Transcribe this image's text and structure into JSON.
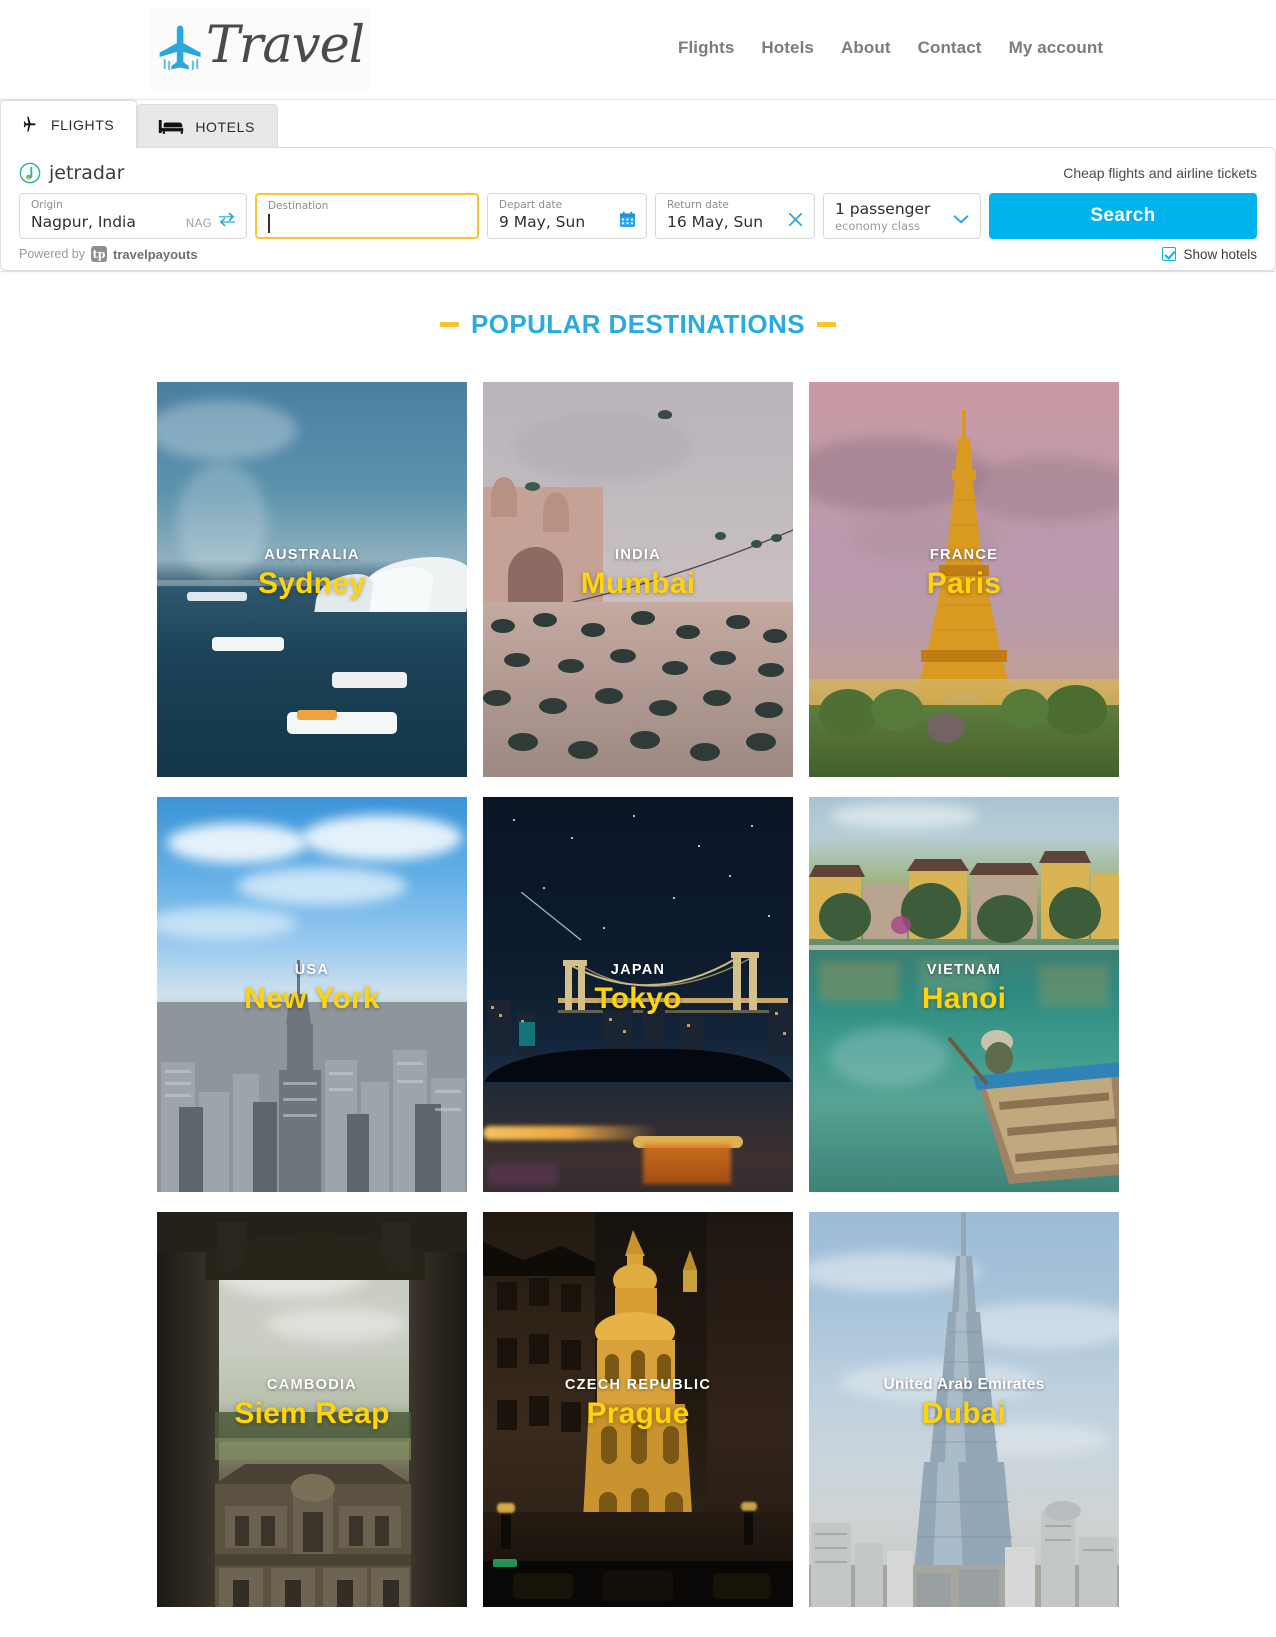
{
  "header": {
    "logo_text": "Travel",
    "logo_icon": "airplane-icon",
    "nav": [
      {
        "label": "Flights"
      },
      {
        "label": "Hotels"
      },
      {
        "label": "About"
      },
      {
        "label": "Contact"
      },
      {
        "label": "My account"
      }
    ]
  },
  "search_widget": {
    "tabs": [
      {
        "label": "FLIGHTS",
        "icon": "airplane-icon",
        "active": true
      },
      {
        "label": "HOTELS",
        "icon": "bed-icon",
        "active": false
      }
    ],
    "brand": "jetradar",
    "tagline": "Cheap flights and airline tickets",
    "origin": {
      "label": "Origin",
      "value": "Nagpur, India",
      "code": "NAG",
      "swap_icon": "swap-arrows-icon"
    },
    "destination": {
      "label": "Destination",
      "value": "",
      "placeholder": ""
    },
    "depart": {
      "label": "Depart date",
      "value": "9 May, Sun",
      "icon": "calendar-icon"
    },
    "return": {
      "label": "Return date",
      "value": "16 May, Sun",
      "icon": "close-icon"
    },
    "passengers": {
      "value": "1 passenger",
      "sub": "economy class",
      "icon": "chevron-down-icon"
    },
    "search_button": "Search",
    "powered_by": "Powered by",
    "powered_brand": "travelpayouts",
    "powered_badge": "tp",
    "show_hotels": {
      "label": "Show hotels",
      "checked": true
    },
    "accent_color": "#00b3eb",
    "focus_color": "#fcc42c"
  },
  "destinations_section": {
    "title": "POPULAR DESTINATIONS",
    "title_color": "#2aaae2",
    "dash_color": "#fcc42c",
    "cards": [
      {
        "country": "AUSTRALIA",
        "city": "Sydney",
        "scene": "sydney"
      },
      {
        "country": "INDIA",
        "city": "Mumbai",
        "scene": "mumbai"
      },
      {
        "country": "FRANCE",
        "city": "Paris",
        "scene": "paris"
      },
      {
        "country": "USA",
        "city": "New York",
        "scene": "newyork"
      },
      {
        "country": "JAPAN",
        "city": "Tokyo",
        "scene": "tokyo"
      },
      {
        "country": "VIETNAM",
        "city": "Hanoi",
        "scene": "hanoi"
      },
      {
        "country": "CAMBODIA",
        "city": "Siem Reap",
        "scene": "siemreap"
      },
      {
        "country": "CZECH REPUBLIC",
        "city": "Prague",
        "scene": "prague"
      },
      {
        "country": "United Arab Emirates",
        "city": "Dubai",
        "scene": "dubai",
        "country_mixed_case": true
      }
    ]
  }
}
